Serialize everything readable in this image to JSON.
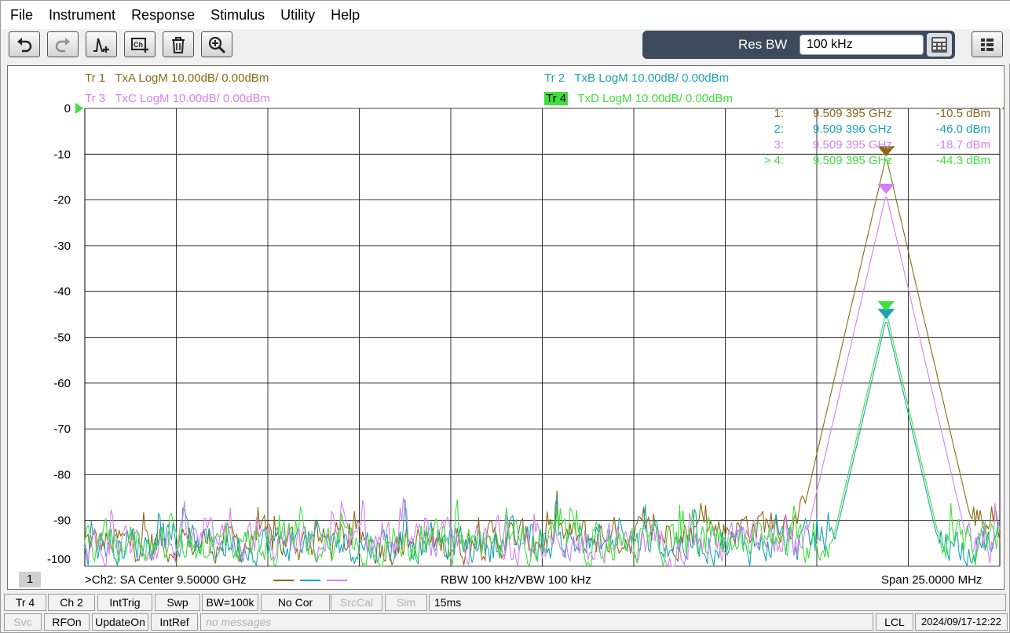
{
  "menu": [
    "File",
    "Instrument",
    "Response",
    "Stimulus",
    "Utility",
    "Help"
  ],
  "toolbar": {
    "buttons": [
      "undo-icon",
      "redo-icon",
      "add-trace-icon",
      "add-channel-icon",
      "delete-icon",
      "zoom-icon"
    ],
    "res_bw_label": "Res BW",
    "res_bw_value": "100 kHz"
  },
  "traces": {
    "tr1": {
      "name": "Tr  1",
      "desc": "TxA LogM 10.00dB/  0.00dBm",
      "color": "#8b6914"
    },
    "tr2": {
      "name": "Tr  2",
      "desc": "TxB LogM 10.00dB/  0.00dBm",
      "color": "#1aa3b0"
    },
    "tr3": {
      "name": "Tr  3",
      "desc": "TxC LogM 10.00dB/  0.00dBm",
      "color": "#d77ff0"
    },
    "tr4": {
      "name": "Tr  4",
      "desc": "TxD LogM 10.00dB/  0.00dBm",
      "color": "#3ee03e"
    }
  },
  "markers": [
    {
      "label": "1:",
      "freq": "9.509 395  GHz",
      "value": "-10.5 dBm",
      "color": "#8b6914"
    },
    {
      "label": "2:",
      "freq": "9.509 396  GHz",
      "value": "-46.0 dBm",
      "color": "#1aa3b0"
    },
    {
      "label": "3:",
      "freq": "9.509 395  GHz",
      "value": "-18.7 dBm",
      "color": "#d77ff0"
    },
    {
      "label": "> 4:",
      "freq": "9.509 395  GHz",
      "value": "-44.3 dBm",
      "color": "#3ee03e"
    }
  ],
  "chart_data": {
    "type": "line",
    "ylim": [
      -100,
      0
    ],
    "yticks": [
      "0",
      "-10",
      "-20",
      "-30",
      "-40",
      "-50",
      "-60",
      "-70",
      "-80",
      "-90",
      "-100"
    ],
    "center_ghz": 9.5,
    "span_mhz": 25,
    "noise_floor_dbm": -95,
    "series": [
      {
        "peak_ghz": 9.509395,
        "peak_dbm": -10.5,
        "color": "#8b6914"
      },
      {
        "peak_ghz": 9.509396,
        "peak_dbm": -46.0,
        "color": "#1aa3b0"
      },
      {
        "peak_ghz": 9.509395,
        "peak_dbm": -18.7,
        "color": "#d77ff0"
      },
      {
        "peak_ghz": 9.509395,
        "peak_dbm": -44.3,
        "color": "#3ee03e"
      }
    ],
    "grid": true
  },
  "bottom": {
    "channel_number": "1",
    "channel_info": ">Ch2: SA  Center  9.50000 GHz",
    "rbw_info": "RBW  100 kHz/VBW  100 kHz",
    "span_info": "Span  25.0000 MHz"
  },
  "status_row1": [
    "Tr 4",
    "Ch 2",
    "IntTrig",
    "Swp",
    "BW=100k",
    "No Cor",
    "SrcCal",
    "Sim",
    "15ms"
  ],
  "status_row2": [
    "Svc",
    "RFOn",
    "UpdateOn",
    "IntRef",
    "no messages",
    "LCL",
    "2024/09/17-12:22"
  ]
}
